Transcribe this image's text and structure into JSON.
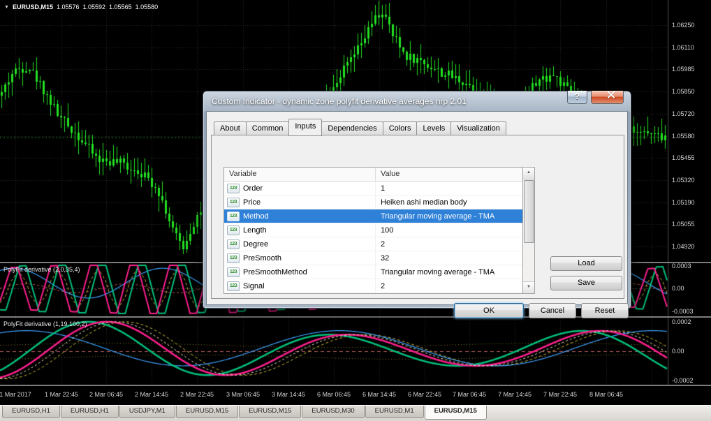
{
  "quote": {
    "symbol": "EURUSD,M15",
    "open": "1.05576",
    "high": "1.05592",
    "low": "1.05565",
    "close": "1.05580"
  },
  "main_chart": {
    "price_labels": [
      "1.06250",
      "1.06110",
      "1.05985",
      "1.05850",
      "1.05720",
      "1.05580",
      "1.05455",
      "1.05320",
      "1.05190",
      "1.05055",
      "1.04920"
    ]
  },
  "indicator1": {
    "label": "PolyFit derivative (2,0,35,4)",
    "axis_labels": [
      "0.0003",
      "0.00",
      "-0.0003"
    ]
  },
  "indicator2": {
    "label": "PolyFit derivative (1,19,100,2)",
    "axis_labels": [
      "0.0002",
      "0.00",
      "-0.0002"
    ]
  },
  "time_axis": [
    "1 Mar 2017",
    "1 Mar 22:45",
    "2 Mar 06:45",
    "2 Mar 14:45",
    "2 Mar 22:45",
    "3 Mar 06:45",
    "3 Mar 14:45",
    "6 Mar 06:45",
    "6 Mar 14:45",
    "6 Mar 22:45",
    "7 Mar 06:45",
    "7 Mar 14:45",
    "7 Mar 22:45",
    "8 Mar 06:45"
  ],
  "chart_tabs": [
    "EURUSD,H1",
    "EURUSD,H1",
    "USDJPY,M1",
    "EURUSD,M15",
    "EURUSD,M15",
    "EURUSD,M30",
    "EURUSD,M1",
    "EURUSD,M15"
  ],
  "active_tab_index": 7,
  "dialog": {
    "title": "Custom Indicator - dynamic zone polyfit derivative averages nrp 2.01",
    "tabs": [
      "About",
      "Common",
      "Inputs",
      "Dependencies",
      "Colors",
      "Levels",
      "Visualization"
    ],
    "active_tab": "Inputs",
    "table": {
      "headers": [
        "Variable",
        "Value"
      ],
      "rows": [
        {
          "name": "Order",
          "value": "1",
          "selected": false
        },
        {
          "name": "Price",
          "value": "Heiken ashi median body",
          "selected": false
        },
        {
          "name": "Method",
          "value": "Triangular moving average - TMA",
          "selected": true
        },
        {
          "name": "Length",
          "value": "100",
          "selected": false
        },
        {
          "name": "Degree",
          "value": "2",
          "selected": false
        },
        {
          "name": "PreSmooth",
          "value": "32",
          "selected": false
        },
        {
          "name": "PreSmoothMethod",
          "value": "Triangular moving average - TMA",
          "selected": false
        },
        {
          "name": "Signal",
          "value": "2",
          "selected": false
        }
      ]
    },
    "buttons": {
      "load": "Load",
      "save": "Save",
      "ok": "OK",
      "cancel": "Cancel",
      "reset": "Reset"
    }
  },
  "icons": {
    "quote_toggle": "▼",
    "help": "?",
    "scroll_up": "▲",
    "scroll_down": "▼",
    "numeric_badge": "123"
  },
  "colors": {
    "candle": "#22e122",
    "bid_line": "#1c8a1c",
    "line_magenta": "#ff1f8f",
    "line_green": "#00c17c",
    "line_blue": "#3fa2ff",
    "line_yellow": "#c9b93a",
    "line_red": "#c05555",
    "zero_line": "#b05858",
    "selection": "#2f80d7",
    "grid": "#282828"
  }
}
